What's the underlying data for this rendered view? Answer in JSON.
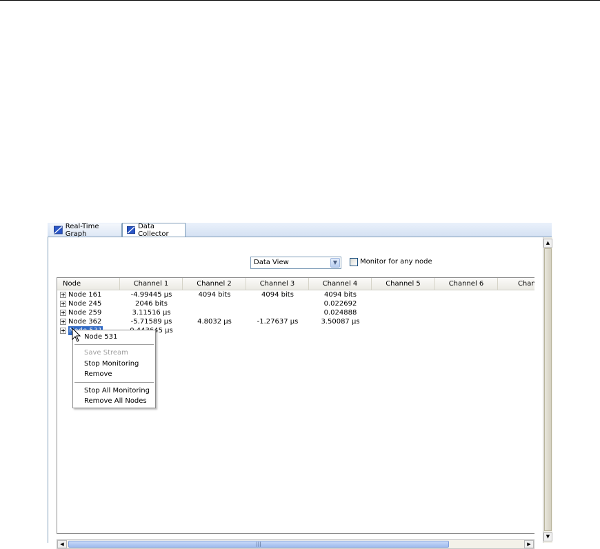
{
  "tabs": [
    {
      "label": "Real-Time Graph",
      "active": false
    },
    {
      "label": "Data Collector",
      "active": true
    }
  ],
  "view_select": {
    "value": "Data View"
  },
  "monitor_checkbox": {
    "label": "Monitor for any node",
    "checked": false
  },
  "table": {
    "columns": [
      "Node",
      "Channel 1",
      "Channel 2",
      "Channel 3",
      "Channel 4",
      "Channel 5",
      "Channel 6",
      "Chann"
    ],
    "rows": [
      {
        "node": "Node 161",
        "c1": "-4.99445 µs",
        "c2": "4094 bits",
        "c3": "4094 bits",
        "c4": "4094 bits"
      },
      {
        "node": "Node 245",
        "c1": "2046 bits",
        "c2": "",
        "c3": "",
        "c4": "0.022692"
      },
      {
        "node": "Node 259",
        "c1": "3.11516 µs",
        "c2": "",
        "c3": "",
        "c4": "0.024888"
      },
      {
        "node": "Node 362",
        "c1": "-5.71589 µs",
        "c2": "4.8032 µs",
        "c3": "-1.27637 µs",
        "c4": "3.50087 µs"
      },
      {
        "node": "Node 531",
        "c1": "0.443645 µs",
        "c2": "",
        "c3": "",
        "c4": ""
      }
    ]
  },
  "context_menu": {
    "header": "Node 531",
    "items": [
      "Save Stream",
      "Stop Monitoring",
      "Remove"
    ],
    "items2": [
      "Stop All Monitoring",
      "Remove All Nodes"
    ]
  },
  "colors": {
    "selection": "#316ac5",
    "accent": "#2a56c6"
  }
}
